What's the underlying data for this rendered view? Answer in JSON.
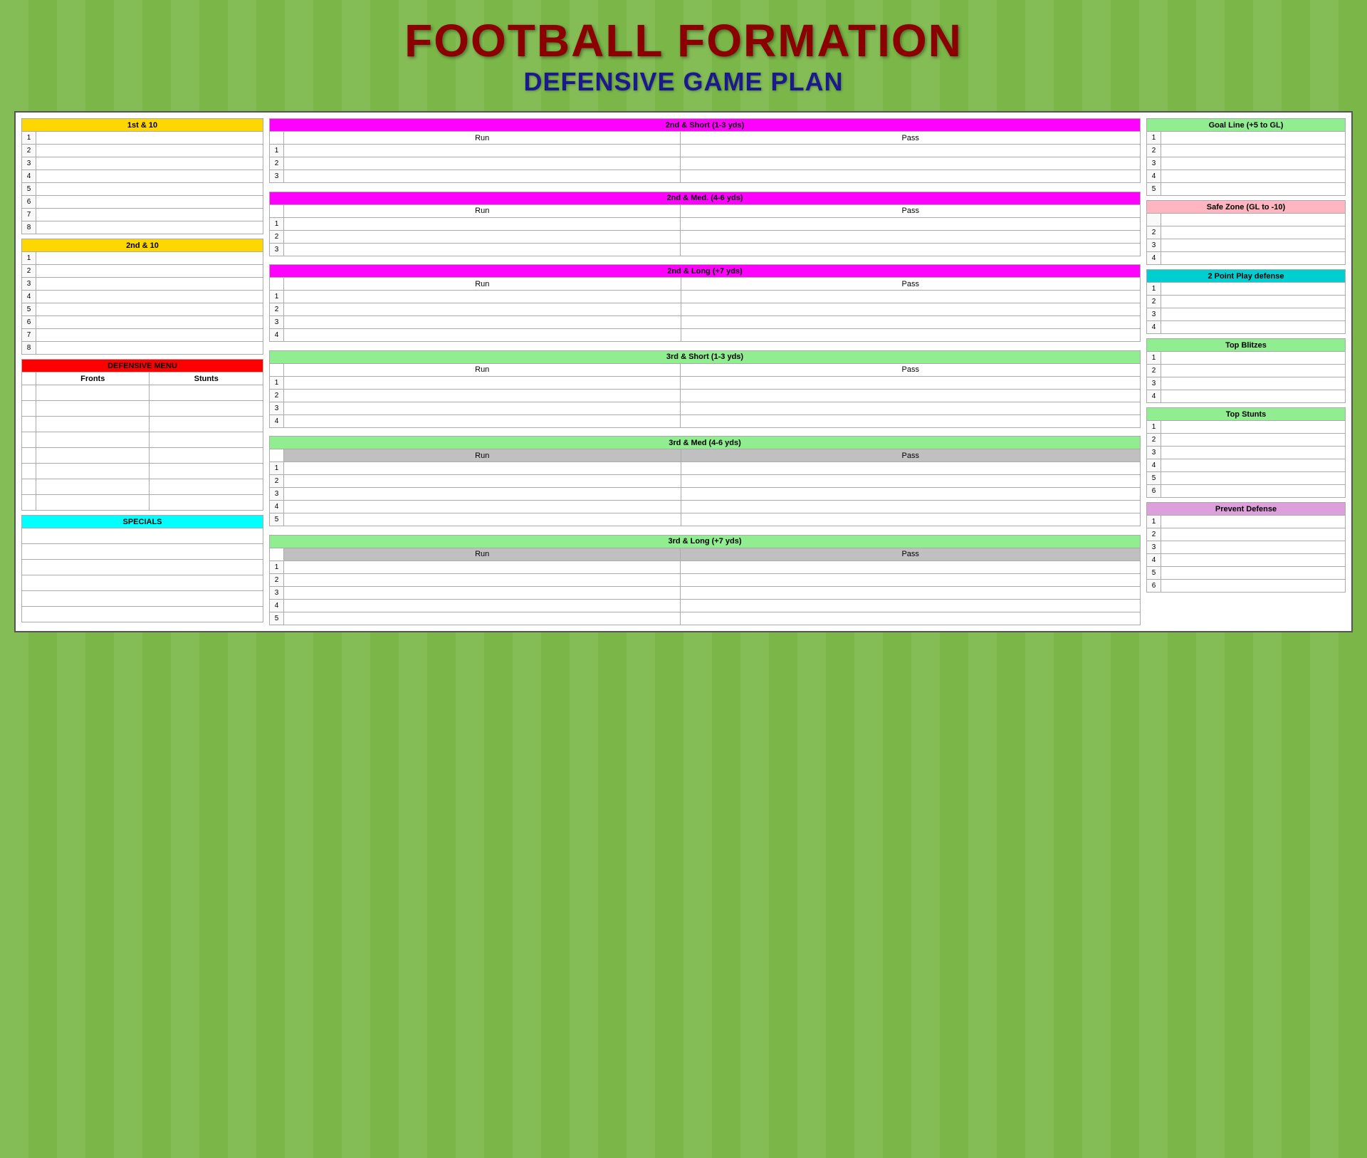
{
  "title": {
    "line1": "FOOTBALL FORMATION",
    "line2": "DEFENSIVE GAME PLAN"
  },
  "left": {
    "first_10_header": "1st & 10",
    "first_10_rows": [
      "1",
      "2",
      "3",
      "4",
      "5",
      "6",
      "7",
      "8"
    ],
    "second_10_header": "2nd & 10",
    "second_10_rows": [
      "1",
      "2",
      "3",
      "4",
      "5",
      "6",
      "7",
      "8"
    ],
    "def_menu_header": "DEFENSIVE MENU",
    "fronts_label": "Fronts",
    "stunts_label": "Stunts",
    "def_menu_rows": 8,
    "specials_header": "SPECIALS",
    "specials_rows": 6
  },
  "middle": {
    "sections": [
      {
        "header": "2nd & Short (1-3 yds)",
        "header_class": "header-magenta",
        "has_run_pass": true,
        "run_label": "Run",
        "pass_label": "Pass",
        "rows": [
          "1",
          "2",
          "3"
        ]
      },
      {
        "header": "2nd & Med. (4-6 yds)",
        "header_class": "header-magenta",
        "has_run_pass": true,
        "run_label": "Run",
        "pass_label": "Pass",
        "rows": [
          "1",
          "2",
          "3"
        ]
      },
      {
        "header": "2nd & Long (+7 yds)",
        "header_class": "header-magenta",
        "has_run_pass": true,
        "run_label": "Run",
        "pass_label": "Pass",
        "rows": [
          "1",
          "2",
          "3",
          "4"
        ]
      },
      {
        "header": "3rd & Short (1-3 yds)",
        "header_class": "header-green",
        "has_run_pass": true,
        "run_label": "Run",
        "pass_label": "Pass",
        "rows": [
          "1",
          "2",
          "3",
          "4"
        ]
      },
      {
        "header": "3rd & Med (4-6 yds)",
        "header_class": "header-green",
        "has_run_pass": true,
        "run_label": "Run",
        "pass_label": "Pass",
        "subheader_class": "subheader-gray",
        "rows": [
          "1",
          "2",
          "3",
          "4",
          "5"
        ]
      },
      {
        "header": "3rd & Long (+7 yds)",
        "header_class": "header-green",
        "has_run_pass": true,
        "run_label": "Run",
        "pass_label": "Pass",
        "subheader_class": "subheader-gray",
        "rows": [
          "1",
          "2",
          "3",
          "4",
          "5"
        ]
      }
    ]
  },
  "right": {
    "sections": [
      {
        "header": "Goal Line (+5 to GL)",
        "header_class": "header-green",
        "rows": [
          "1",
          "2",
          "3",
          "4",
          "5"
        ]
      },
      {
        "header": "Safe Zone (GL to -10)",
        "header_class": "header-pink",
        "rows": [
          "",
          "2",
          "3",
          "4"
        ]
      },
      {
        "header": "2 Point Play defense",
        "header_class": "header-teal",
        "rows": [
          "1",
          "2",
          "3",
          "4"
        ]
      },
      {
        "header": "Top Blitzes",
        "header_class": "header-lightgreen",
        "rows": [
          "1",
          "2",
          "3",
          "4"
        ]
      },
      {
        "header": "Top Stunts",
        "header_class": "header-lightgreen",
        "rows": [
          "1",
          "2",
          "3",
          "4",
          "5",
          "6"
        ]
      },
      {
        "header": "Prevent Defense",
        "header_class": "header-lightpurple",
        "rows": [
          "1",
          "2",
          "3",
          "4",
          "5",
          "6"
        ]
      }
    ]
  }
}
